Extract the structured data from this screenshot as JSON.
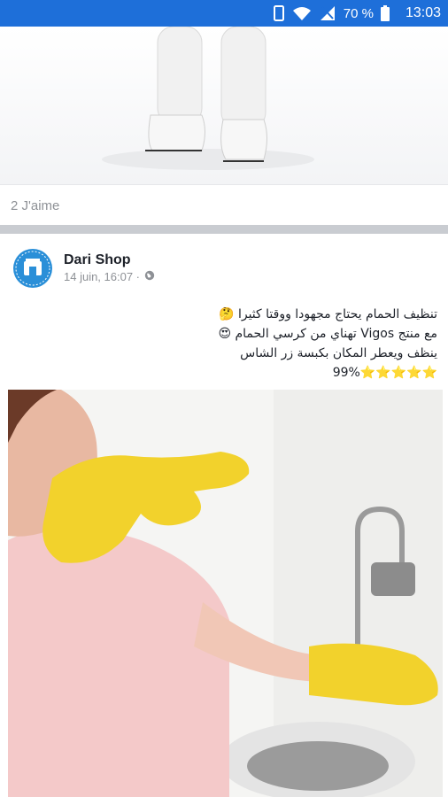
{
  "status_bar": {
    "battery": "70 %",
    "time": "13:03"
  },
  "previous_post": {
    "likes": "2 J'aime"
  },
  "post": {
    "author": "Dari Shop",
    "timestamp": "14 juin, 16:07 ·",
    "privacy_icon": "globe-icon",
    "text_lines": [
      "تنظيف الحمام يحتاج مجهودا ووقتا كثيرا 🤔",
      "مع منتج Vigos تهناي من كرسي الحمام 😍",
      "ينظف ويعطر المكان بكبسة زر الشاس",
      "⭐⭐⭐⭐⭐99%"
    ]
  },
  "colors": {
    "status_bar": "#1e6fd9",
    "avatar": "#2a8fd8",
    "glove": "#f2d22c"
  }
}
